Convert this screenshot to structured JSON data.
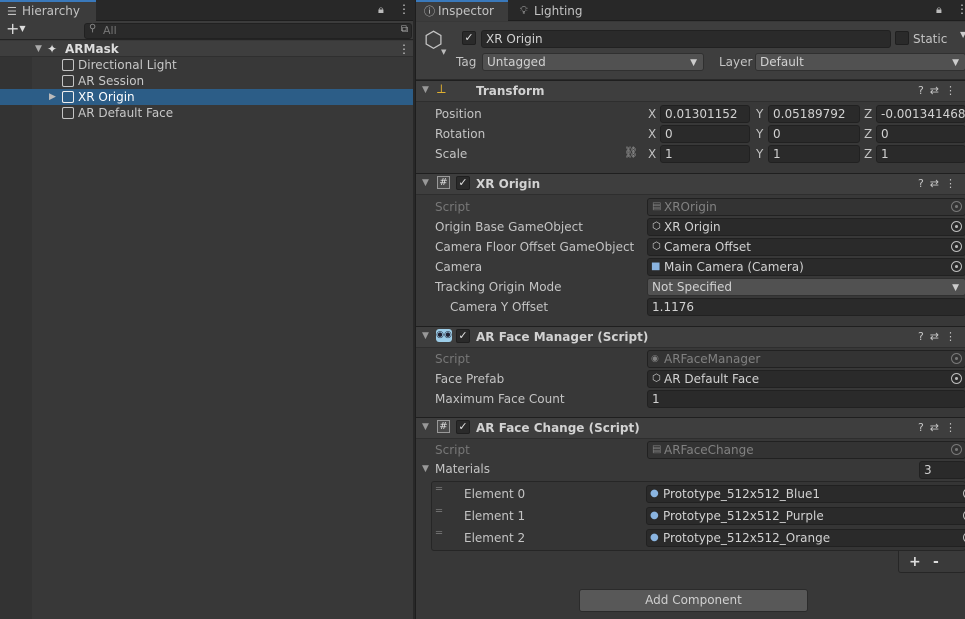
{
  "hierarchy": {
    "tab_label": "Hierarchy",
    "search_placeholder": "All",
    "scene_name": "ARMask",
    "items": [
      {
        "label": "Directional Light"
      },
      {
        "label": "AR Session"
      },
      {
        "label": "XR Origin"
      },
      {
        "label": "AR Default Face"
      }
    ],
    "selected_index": 2
  },
  "tabs": {
    "inspector": "Inspector",
    "lighting": "Lighting"
  },
  "object": {
    "name": "XR Origin",
    "active": true,
    "static_label": "Static",
    "tag_label": "Tag",
    "tag_value": "Untagged",
    "layer_label": "Layer",
    "layer_value": "Default"
  },
  "transform": {
    "title": "Transform",
    "position_label": "Position",
    "rotation_label": "Rotation",
    "scale_label": "Scale",
    "axes": {
      "x": "X",
      "y": "Y",
      "z": "Z"
    },
    "position": {
      "x": "0.01301152",
      "y": "0.05189792",
      "z": "-0.001341468"
    },
    "rotation": {
      "x": "0",
      "y": "0",
      "z": "0"
    },
    "scale": {
      "x": "1",
      "y": "1",
      "z": "1"
    }
  },
  "xr_origin": {
    "title": "XR Origin",
    "script_label": "Script",
    "script_value": "XROrigin",
    "origin_base_label": "Origin Base GameObject",
    "origin_base_value": "XR Origin",
    "camera_floor_label": "Camera Floor Offset GameObject",
    "camera_floor_value": "Camera Offset",
    "camera_label": "Camera",
    "camera_value": "Main Camera (Camera)",
    "tracking_mode_label": "Tracking Origin Mode",
    "tracking_mode_value": "Not Specified",
    "camera_y_offset_label": "Camera Y Offset",
    "camera_y_offset_value": "1.1176"
  },
  "face_manager": {
    "title": "AR Face Manager (Script)",
    "script_label": "Script",
    "script_value": "ARFaceManager",
    "face_prefab_label": "Face Prefab",
    "face_prefab_value": "AR Default Face",
    "max_face_label": "Maximum Face Count",
    "max_face_value": "1"
  },
  "face_change": {
    "title": "AR Face Change (Script)",
    "script_label": "Script",
    "script_value": "ARFaceChange",
    "materials_label": "Materials",
    "materials_count": "3",
    "elements": [
      {
        "label": "Element 0",
        "value": "Prototype_512x512_Blue1"
      },
      {
        "label": "Element 1",
        "value": "Prototype_512x512_Purple"
      },
      {
        "label": "Element 2",
        "value": "Prototype_512x512_Orange"
      }
    ],
    "add_label": "+",
    "remove_label": "-"
  },
  "add_component_label": "Add Component",
  "colors": {
    "selection": "#2c5d87",
    "accent": "#3a79bb",
    "panel": "#383838"
  }
}
